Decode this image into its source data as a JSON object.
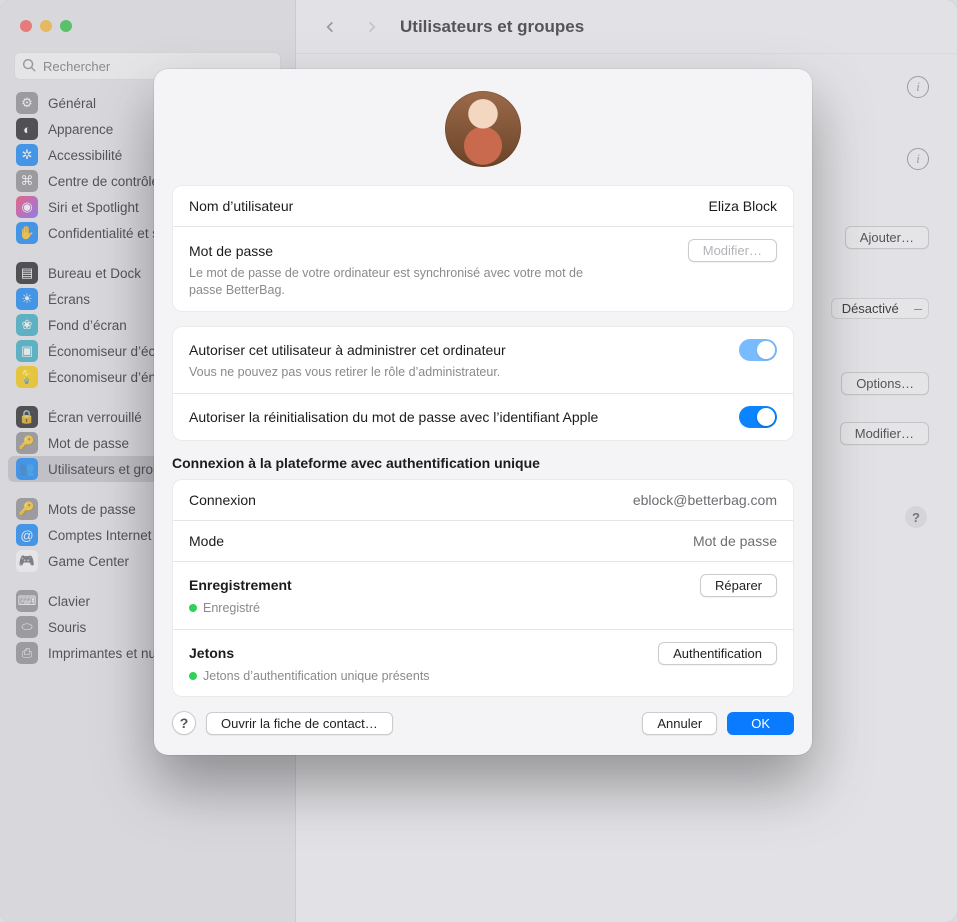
{
  "window": {
    "title": "Utilisateurs et groupes",
    "search_placeholder": "Rechercher"
  },
  "sidebar": {
    "items": [
      {
        "label": "Général",
        "icon_bg": "#8e8e93",
        "glyph": "⚙"
      },
      {
        "label": "Apparence",
        "icon_bg": "#1c1c1e",
        "glyph": "◐"
      },
      {
        "label": "Accessibilité",
        "icon_bg": "#0a84ff",
        "glyph": "✲"
      },
      {
        "label": "Centre de contrôle",
        "icon_bg": "#8e8e93",
        "glyph": "⌘"
      },
      {
        "label": "Siri et Spotlight",
        "icon_bg": "linear-gradient(135deg,#ff3b6b,#7b61ff)",
        "glyph": "◉"
      },
      {
        "label": "Confidentialité et sécurité",
        "icon_bg": "#0a84ff",
        "glyph": "✋"
      },
      {
        "gap": true
      },
      {
        "label": "Bureau et Dock",
        "icon_bg": "#1c1c1e",
        "glyph": "▤"
      },
      {
        "label": "Écrans",
        "icon_bg": "#0a84ff",
        "glyph": "☀"
      },
      {
        "label": "Fond d’écran",
        "icon_bg": "#30b0c7",
        "glyph": "❀"
      },
      {
        "label": "Économiseur d’écran",
        "icon_bg": "#30b0c7",
        "glyph": "▣"
      },
      {
        "label": "Économiseur d’énergie",
        "icon_bg": "#ffcc00",
        "glyph": "💡"
      },
      {
        "gap": true
      },
      {
        "label": "Écran verrouillé",
        "icon_bg": "#1c1c1e",
        "glyph": "🔒"
      },
      {
        "label": "Mot de passe",
        "icon_bg": "#8e8e93",
        "glyph": "🔑"
      },
      {
        "label": "Utilisateurs et groupes",
        "icon_bg": "#0a84ff",
        "glyph": "👥",
        "selected": true
      },
      {
        "gap": true
      },
      {
        "label": "Mots de passe",
        "icon_bg": "#8e8e93",
        "glyph": "🔑"
      },
      {
        "label": "Comptes Internet",
        "icon_bg": "#0a84ff",
        "glyph": "@"
      },
      {
        "label": "Game Center",
        "icon_bg": "#ffffff",
        "glyph": "🎮",
        "fg": "#555"
      },
      {
        "gap": true
      },
      {
        "label": "Clavier",
        "icon_bg": "#8e8e93",
        "glyph": "⌨"
      },
      {
        "label": "Souris",
        "icon_bg": "#8e8e93",
        "glyph": "⬭"
      },
      {
        "label": "Imprimantes et numériseurs",
        "icon_bg": "#8e8e93",
        "glyph": "⎙"
      }
    ]
  },
  "content": {
    "add_button": "Ajouter…",
    "auto_login_value": "Désactivé",
    "options_button": "Options…",
    "modify_button": "Modifier…"
  },
  "modal": {
    "username_label": "Nom d’utilisateur",
    "username_value": "Eliza Block",
    "password_label": "Mot de passe",
    "password_button": "Modifier…",
    "password_sub": "Le mot de passe de votre ordinateur est synchronisé avec votre mot de passe BetterBag.",
    "admin_label": "Autoriser cet utilisateur à administrer cet ordinateur",
    "admin_sub": "Vous ne pouvez pas vous retirer le rôle d’administrateur.",
    "appleid_reset_label": "Autoriser la réinitialisation du mot de passe avec l’identifiant Apple",
    "sso_title": "Connexion à la plateforme avec authentification unique",
    "sso_login_label": "Connexion",
    "sso_login_value": "eblock@betterbag.com",
    "sso_mode_label": "Mode",
    "sso_mode_value": "Mot de passe",
    "sso_reg_label": "Enregistrement",
    "sso_reg_status": "Enregistré",
    "sso_reg_button": "Réparer",
    "sso_tokens_label": "Jetons",
    "sso_tokens_status": "Jetons d’authentification unique présents",
    "sso_tokens_button": "Authentification",
    "open_contact": "Ouvrir la fiche de contact…",
    "cancel": "Annuler",
    "ok": "OK"
  }
}
